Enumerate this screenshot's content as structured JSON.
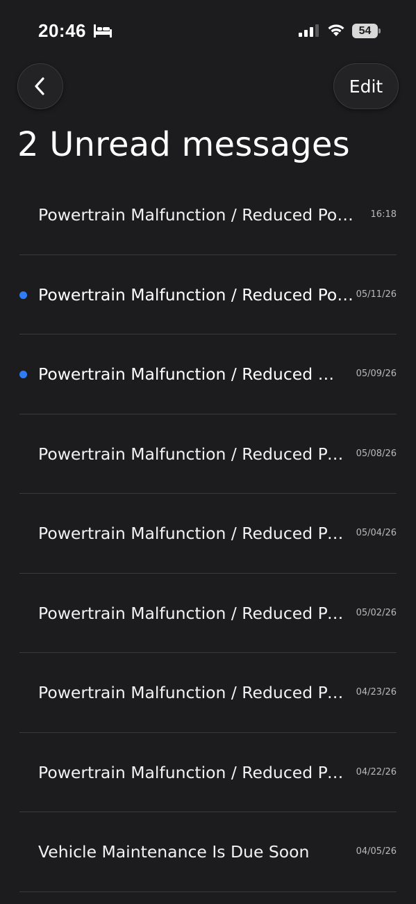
{
  "status_bar": {
    "time": "20:46",
    "battery": "54",
    "icons": [
      "bed-icon",
      "signal-icon",
      "wifi-icon",
      "battery-icon"
    ]
  },
  "header": {
    "back_icon": "chevron-left-icon",
    "edit_label": "Edit",
    "title": "2 Unread messages"
  },
  "messages": [
    {
      "title": "Powertrain Malfunction / Reduced Power",
      "date": "16:18",
      "unread": false
    },
    {
      "title": "Powertrain Malfunction / Reduced Power",
      "date": "05/11/26",
      "unread": true
    },
    {
      "title": "Powertrain Malfunction / Reduced Power",
      "date": "05/09/26",
      "unread": true
    },
    {
      "title": "Powertrain Malfunction / Reduced Power",
      "date": "05/08/26",
      "unread": false
    },
    {
      "title": "Powertrain Malfunction / Reduced Power",
      "date": "05/04/26",
      "unread": false
    },
    {
      "title": "Powertrain Malfunction / Reduced Power",
      "date": "05/02/26",
      "unread": false
    },
    {
      "title": "Powertrain Malfunction / Reduced Power",
      "date": "04/23/26",
      "unread": false
    },
    {
      "title": "Powertrain Malfunction / Reduced Power",
      "date": "04/22/26",
      "unread": false
    },
    {
      "title": "Vehicle Maintenance Is Due Soon",
      "date": "04/05/26",
      "unread": false
    }
  ],
  "colors": {
    "background": "#1c1c1e",
    "unread_dot": "#2f7cf6",
    "divider": "#3a3a3c"
  }
}
